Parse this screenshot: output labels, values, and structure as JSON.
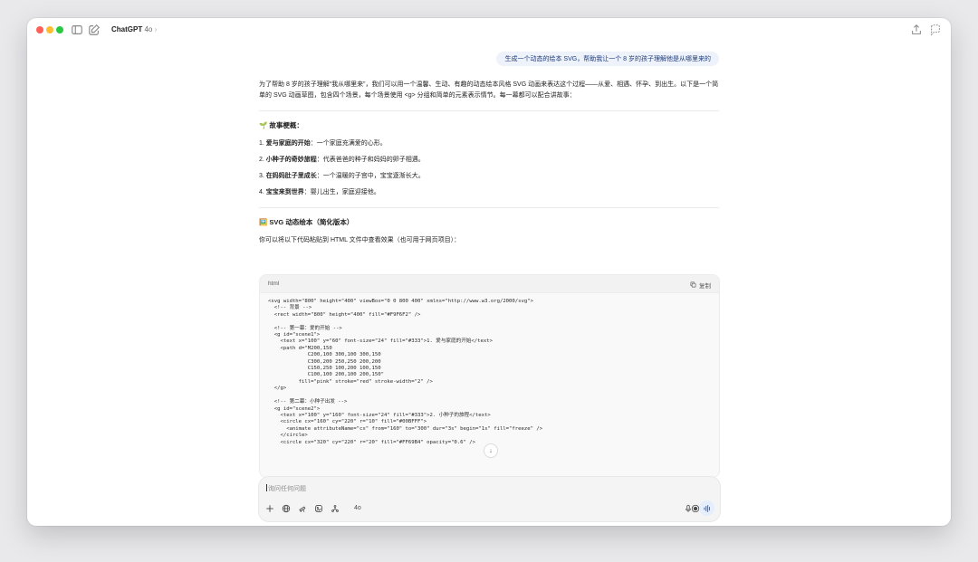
{
  "titlebar": {
    "model_name": "ChatGPT",
    "model_version": "4o",
    "chevron": "›",
    "icons": [
      "sidebar-toggle-icon",
      "new-chat-icon",
      "share-icon",
      "temporary-chat-icon"
    ]
  },
  "user_message": "生成一个动态的绘本 SVG，帮助我让一个 8 岁的孩子理解他是从哪里来的",
  "assistant": {
    "intro": "为了帮助 8 岁的孩子理解“我从哪里来”，我们可以用一个温馨、生动、有趣的动态绘本风格 SVG 动画来表达这个过程——从爱、相遇、怀孕、到出生。以下是一个简单的 SVG 动画草图，包含四个场景，每个场景使用 <g> 分组和简单的元素表示情节。每一幕都可以配合讲故事：",
    "story_heading": "🌱 故事梗概：",
    "story_items": [
      {
        "num": "1.",
        "title": "爱与家庭的开始",
        "desc": "：一个家庭充满爱的心形。"
      },
      {
        "num": "2.",
        "title": "小种子的奇妙旅程",
        "desc": "：代表爸爸的种子和妈妈的卵子相遇。"
      },
      {
        "num": "3.",
        "title": "在妈妈肚子里成长",
        "desc": "：一个温暖的子宫中，宝宝逐渐长大。"
      },
      {
        "num": "4.",
        "title": "宝宝来到世界",
        "desc": "：婴儿出生，家庭迎接他。"
      }
    ],
    "svg_heading": "🖼️ SVG 动态绘本（简化版本）",
    "paste_hint": "你可以将以下代码粘贴到 HTML 文件中查看效果（也可用于网页项目）：",
    "code_lang": "html",
    "copy_label": "复制",
    "code": "<svg width=\"800\" height=\"400\" viewBox=\"0 0 800 400\" xmlns=\"http://www.w3.org/2000/svg\">\n  <!-- 背景 -->\n  <rect width=\"800\" height=\"400\" fill=\"#F9F6F2\" />\n\n  <!-- 第一幕：爱的开始 -->\n  <g id=\"scene1\">\n    <text x=\"100\" y=\"60\" font-size=\"24\" fill=\"#333\">1. 爱与家庭的开始</text>\n    <path d=\"M200,150\n             C200,100 300,100 300,150\n             C300,200 250,250 200,200\n             C150,250 100,200 100,150\n             C100,100 200,100 200,150\"\n          fill=\"pink\" stroke=\"red\" stroke-width=\"2\" />\n  </g>\n\n  <!-- 第二幕：小种子出发 -->\n  <g id=\"scene2\">\n    <text x=\"100\" y=\"160\" font-size=\"24\" fill=\"#333\">2. 小种子的旅程</text>\n    <circle cx=\"160\" cy=\"220\" r=\"10\" fill=\"#00BFFF\">\n      <animate attributeName=\"cx\" from=\"160\" to=\"300\" dur=\"3s\" begin=\"1s\" fill=\"freeze\" />\n    </circle>\n    <circle cx=\"320\" cy=\"220\" r=\"20\" fill=\"#FF69B4\" opacity=\"0.6\" />"
  },
  "composer": {
    "placeholder": "询问任何问题",
    "model_label": "4o"
  },
  "colors": {
    "user_bubble_bg": "#eef3fb",
    "accent_blue": "#2f6fe0"
  }
}
